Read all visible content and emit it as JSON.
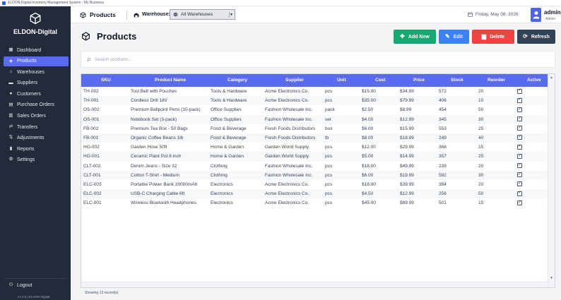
{
  "window": {
    "title": "ELDON-Digital Inventory Management System  -  My Business"
  },
  "sidebar": {
    "brand": "ELDON-Digital",
    "items": [
      {
        "label": "Dashboard",
        "icon": "dashboard-icon",
        "active": false
      },
      {
        "label": "Products",
        "icon": "products-icon",
        "active": true
      },
      {
        "label": "Warehouses",
        "icon": "warehouses-icon",
        "active": false
      },
      {
        "label": "Suppliers",
        "icon": "suppliers-icon",
        "active": false
      },
      {
        "label": "Customers",
        "icon": "customers-icon",
        "active": false
      },
      {
        "label": "Purchase Orders",
        "icon": "purchase-orders-icon",
        "active": false
      },
      {
        "label": "Sales Orders",
        "icon": "sales-orders-icon",
        "active": false
      },
      {
        "label": "Transfers",
        "icon": "transfers-icon",
        "active": false
      },
      {
        "label": "Adjustments",
        "icon": "adjustments-icon",
        "active": false
      },
      {
        "label": "Reports",
        "icon": "reports-icon",
        "active": false
      },
      {
        "label": "Settings",
        "icon": "settings-icon",
        "active": false
      }
    ],
    "logout": "Logout",
    "version": "v1.0.0  |  ELDON-Digital"
  },
  "header": {
    "title": "Products",
    "warehouse_label": "Warehouse:",
    "warehouse_value": "All Warehouses",
    "date": "Friday, May 08, 2026",
    "user_name": "admin",
    "user_role": "Admin"
  },
  "page": {
    "title": "Products",
    "buttons": {
      "add": "Add New",
      "edit": "Edit",
      "delete": "Delete",
      "refresh": "Refresh"
    },
    "search_placeholder": "Search products..."
  },
  "table": {
    "columns": [
      "SKU",
      "Product Name",
      "Category",
      "Supplier",
      "Unit",
      "Cost",
      "Price",
      "Stock",
      "Reorder",
      "Active"
    ],
    "rows": [
      {
        "sku": "TH-002",
        "name": "Tool Belt with Pouches",
        "category": "Tools & Hardware",
        "supplier": "Acme Electronics Co.",
        "unit": "pcs",
        "cost": "$15.00",
        "price": "$34.99",
        "stock": "572",
        "reorder": "20",
        "active": true
      },
      {
        "sku": "TH-001",
        "name": "Cordless Drill 18V",
        "category": "Tools & Hardware",
        "supplier": "Acme Electronics Co.",
        "unit": "pcs",
        "cost": "$35.00",
        "price": "$79.99",
        "stock": "406",
        "reorder": "10",
        "active": true
      },
      {
        "sku": "OS-002",
        "name": "Premium Ballpoint Pens (10-pack)",
        "category": "Office Supplies",
        "supplier": "Fashion Wholesale Inc.",
        "unit": "pack",
        "cost": "$2.50",
        "price": "$8.99",
        "stock": "454",
        "reorder": "50",
        "active": true
      },
      {
        "sku": "OS-001",
        "name": "Notebook Set (3-pack)",
        "category": "Office Supplies",
        "supplier": "Fashion Wholesale Inc.",
        "unit": "set",
        "cost": "$4.00",
        "price": "$12.99",
        "stock": "345",
        "reorder": "30",
        "active": true
      },
      {
        "sku": "FB-002",
        "name": "Premium Tea Box - 50 Bags",
        "category": "Food & Beverage",
        "supplier": "Fresh Foods Distributors",
        "unit": "box",
        "cost": "$6.00",
        "price": "$15.99",
        "stock": "553",
        "reorder": "25",
        "active": true
      },
      {
        "sku": "FB-001",
        "name": "Organic Coffee Beans 1lb",
        "category": "Food & Beverage",
        "supplier": "Fresh Foods Distributors",
        "unit": "lb",
        "cost": "$8.00",
        "price": "$18.99",
        "stock": "249",
        "reorder": "40",
        "active": true
      },
      {
        "sku": "HG-002",
        "name": "Garden Hose 50ft",
        "category": "Home & Garden",
        "supplier": "Garden World Supply",
        "unit": "pcs",
        "cost": "$12.00",
        "price": "$29.99",
        "stock": "368",
        "reorder": "15",
        "active": true
      },
      {
        "sku": "HG-001",
        "name": "Ceramic Plant Pot 8 inch",
        "category": "Home & Garden",
        "supplier": "Garden World Supply",
        "unit": "pcs",
        "cost": "$5.00",
        "price": "$14.99",
        "stock": "357",
        "reorder": "25",
        "active": true
      },
      {
        "sku": "CLT-002",
        "name": "Denim Jeans - Size 32",
        "category": "Clothing",
        "supplier": "Fashion Wholesale Inc.",
        "unit": "pcs",
        "cost": "$18.00",
        "price": "$49.99",
        "stock": "239",
        "reorder": "20",
        "active": true
      },
      {
        "sku": "CLT-001",
        "name": "Cotton T-Shirt - Medium",
        "category": "Clothing",
        "supplier": "Fashion Wholesale Inc.",
        "unit": "pcs",
        "cost": "$6.00",
        "price": "$19.99",
        "stock": "582",
        "reorder": "30",
        "active": true
      },
      {
        "sku": "ELC-003",
        "name": "Portable Power Bank 20000mAh",
        "category": "Electronics",
        "supplier": "Acme Electronics Co.",
        "unit": "pcs",
        "cost": "$18.00",
        "price": "$39.99",
        "stock": "384",
        "reorder": "20",
        "active": true
      },
      {
        "sku": "ELC-002",
        "name": "USB-C Charging Cable 6ft",
        "category": "Electronics",
        "supplier": "Acme Electronics Co.",
        "unit": "pcs",
        "cost": "$4.50",
        "price": "$12.99",
        "stock": "256",
        "reorder": "50",
        "active": true
      },
      {
        "sku": "ELC-001",
        "name": "Wireless Bluetooth Headphones",
        "category": "Electronics",
        "supplier": "Acme Electronics Co.",
        "unit": "pcs",
        "cost": "$45.00",
        "price": "$89.99",
        "stock": "501",
        "reorder": "15",
        "active": true
      }
    ]
  },
  "status": "Showing 13 record(s)",
  "colors": {
    "sidebar_bg": "#232b3a",
    "accent": "#5b6bf0",
    "add": "#16a870",
    "edit": "#3b82f6",
    "delete": "#ef4444",
    "refresh": "#344256"
  }
}
